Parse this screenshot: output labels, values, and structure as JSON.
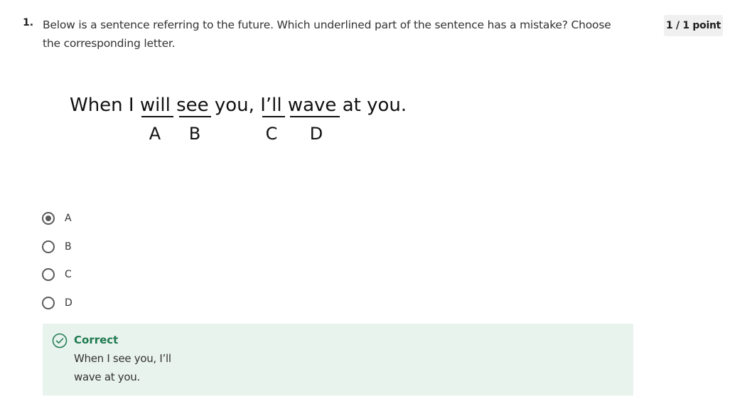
{
  "question": {
    "number": "1.",
    "prompt": "Below is a sentence referring to the future. Which underlined part of the sentence has a mistake? Choose the corresponding letter.",
    "points": "1 / 1 point"
  },
  "sentence_figure": {
    "text_parts": [
      "When I ",
      "will",
      " ",
      "see",
      " you, ",
      "I’ll",
      " ",
      "wave",
      " at you."
    ],
    "letters": [
      "A",
      "B",
      "C",
      "D"
    ]
  },
  "options": [
    {
      "label": "A",
      "selected": true
    },
    {
      "label": "B",
      "selected": false
    },
    {
      "label": "C",
      "selected": false
    },
    {
      "label": "D",
      "selected": false
    }
  ],
  "feedback": {
    "status": "Correct",
    "explanation": " When I see you, I’ll wave at you.",
    "color": "#1e7a4f",
    "background": "#e9f3ee",
    "icon": "check-circle-icon"
  }
}
